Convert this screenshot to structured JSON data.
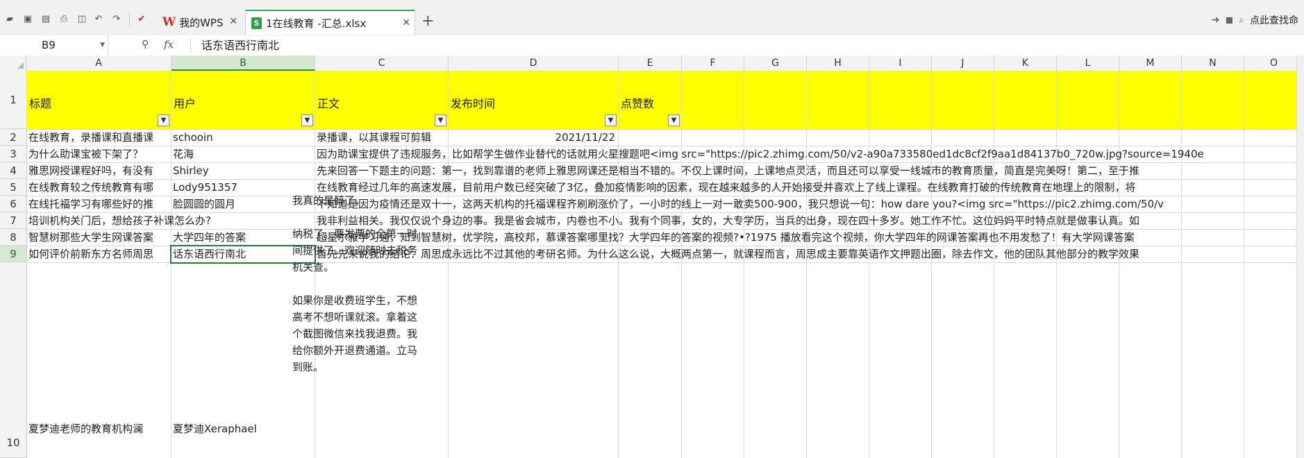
{
  "toolbar": {
    "tabs": [
      {
        "label": "我的WPS"
      },
      {
        "label": "1在线教育 -汇总.xlsx"
      }
    ],
    "search_label": "点此查找命"
  },
  "formula_bar": {
    "cell_ref": "B9",
    "fx": "fx",
    "value": "话东语西行南北"
  },
  "columns": [
    "A",
    "B",
    "C",
    "D",
    "E",
    "F",
    "G",
    "H",
    "I",
    "J",
    "K",
    "L",
    "M",
    "N",
    "O"
  ],
  "rows": [
    "1",
    "2",
    "3",
    "4",
    "5",
    "6",
    "7",
    "8",
    "9",
    "10"
  ],
  "header_row": {
    "a": "标题",
    "b": "用户",
    "c": "正文",
    "d": "发布时间",
    "e": "点赞数"
  },
  "data_rows": [
    {
      "a": "在线教育，录播课和直播课",
      "b": "schooin",
      "c": "录播课，以其课程可剪辑",
      "d": "2021/11/22"
    },
    {
      "a": "为什么助课宝被下架了？",
      "b": "花海",
      "c": "因为助课宝提供了违规服务，比如帮学生做作业替代的话就用火星搜题吧<img src=\"https://pic2.zhimg.com/50/v2-a90a733580ed1dc8cf2f9aa1d84137b0_720w.jpg?source=1940e"
    },
    {
      "a": "雅思网授课程好吗，有没有",
      "b": "Shirley",
      "c": "先来回答一下题主的问题：第一，找到靠谱的老师上雅思网课还是相当不错的。不仅上课时间，上课地点灵活，而且还可以享受一线城市的教育质量，简直是完美呀！第二，至于推"
    },
    {
      "a": "在线教育较之传统教育有哪",
      "b": "Lody951357",
      "c": "在线教育经过几年的高速发展，目前用户数已经突破了3亿，叠加疫情影响的因素，现在越来越多的人开始接受并喜欢上了线上课程。在线教育打破的传统教育在地理上的限制，将"
    },
    {
      "a": "在线托福学习有哪些好的推",
      "b": "脸圆圆的圆月",
      "c": "不知道是因为疫情还是双十一，这两天机构的托福课程齐刷刷涨价了，一小时的线上一对一敢卖500-900，我只想说一句：how dare you?<img src=\"https://pic2.zhimg.com/50/v"
    },
    {
      "a": "培训机构关门后，想给孩子补课怎么办?",
      "b": "",
      "c": "我非利益相关。我仅仅说个身边的事。我是省会城市，内卷也不小。我有个同事，女的，大专学历，当兵的出身，现在四十多岁。她工作不忙。这位妈妈平时特点就是做事认真。如"
    },
    {
      "a": "智慧树那些大学生网课答案",
      "b": "大学四年的答案",
      "c": "超星尔雅学习通，知到智慧树，优学院，高校邦，慕课答案哪里找？大学四年的答案的视频?•?1975 播放看完这个视频，你大学四年的网课答案再也不用发愁了！有大学网课答案"
    },
    {
      "a": "如何评价前新东方名师周思",
      "b": "话东语西行南北",
      "c": "首先先来说我的结论：周思成永远比不过其他的考研名师。为什么这么说，大概两点第一，就课程而言，周思成主要靠英语作文押题出圈，除去作文，他的团队其他部分的教学效果"
    }
  ],
  "row10": {
    "a": "夏梦迪老师的教育机构澜",
    "b": "夏梦迪Xeraphael",
    "c": "我真的是醉了。\n\n纳税了。要发票的全第一时间提供了。欢迎随时去税务机关查。\n\n如果你是收费班学生，不想高考不想听课就滚。拿着这个截图微信来找我退费。我给你额外开退费通道。立马到账。"
  },
  "colors": {
    "header_fill": "#ffff00",
    "selection": "#1f7a35",
    "active_tab_accent": "#34a853",
    "wps_logo": "#d62828"
  }
}
